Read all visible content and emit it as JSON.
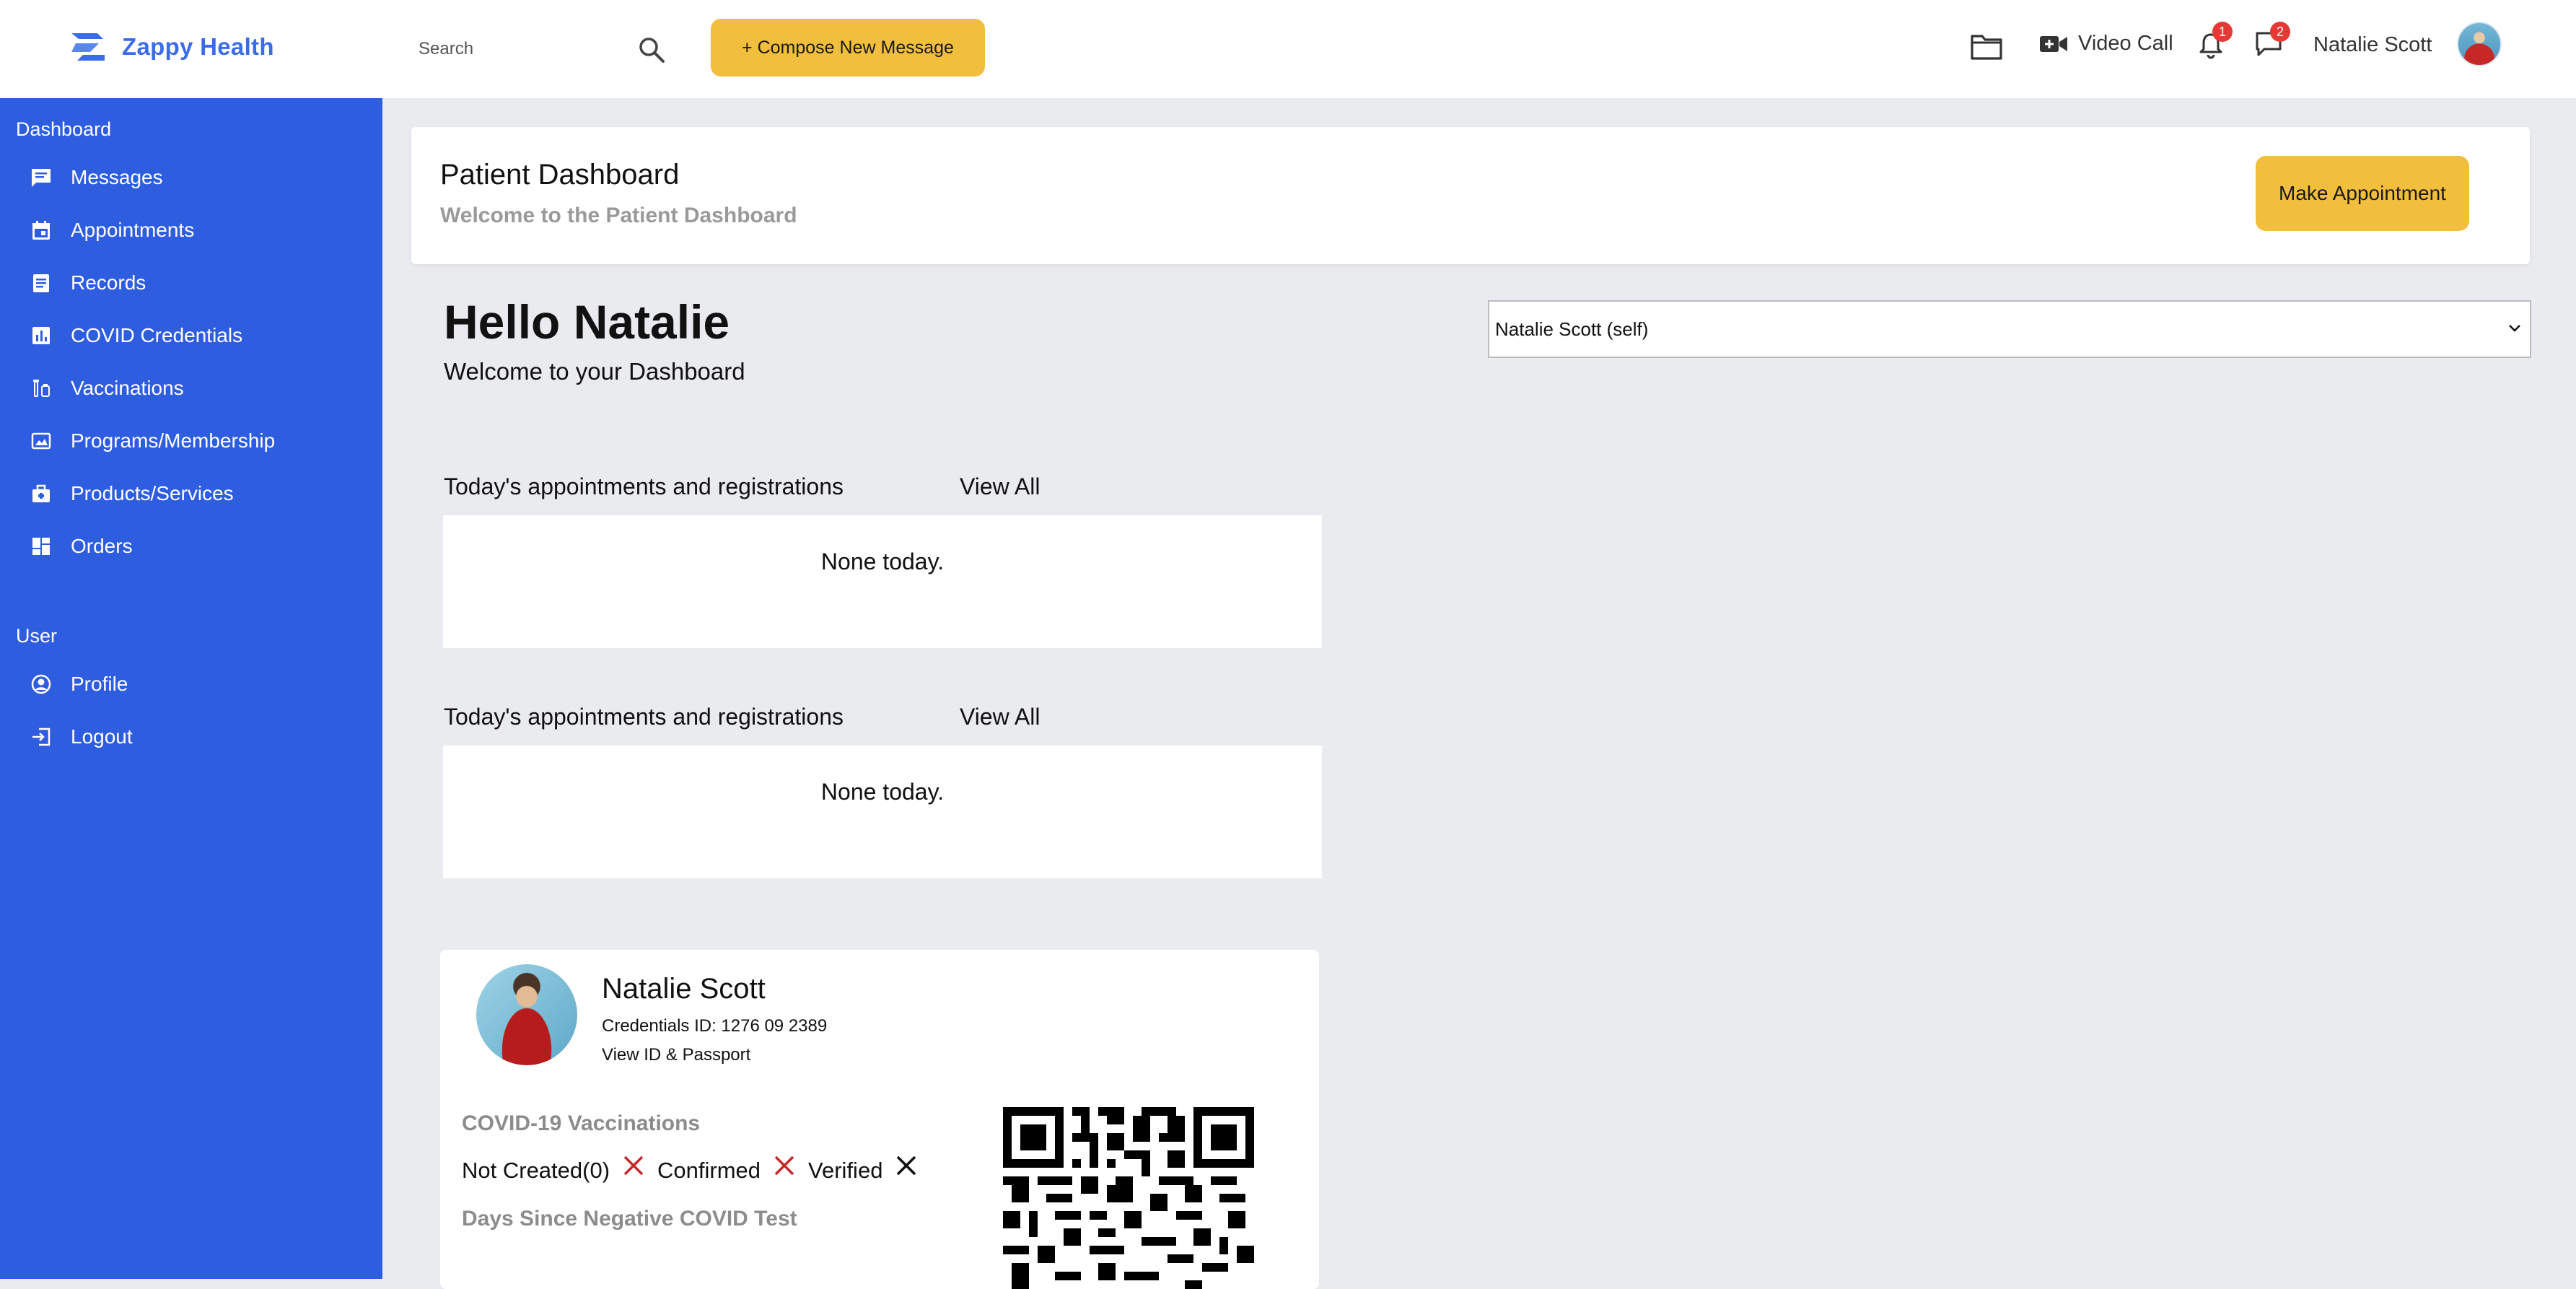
{
  "app": {
    "name": "Zappy Health"
  },
  "topbar": {
    "search_placeholder": "Search",
    "compose_label": "+ Compose New Message",
    "video_call_label": "Video Call",
    "notifications_count": "1",
    "messages_count": "2",
    "user_name": "Natalie Scott"
  },
  "sidebar": {
    "dashboard_section": "Dashboard",
    "items": [
      {
        "label": "Messages",
        "icon": "message-icon"
      },
      {
        "label": "Appointments",
        "icon": "calendar-icon"
      },
      {
        "label": "Records",
        "icon": "records-icon"
      },
      {
        "label": "COVID Credentials",
        "icon": "chart-icon"
      },
      {
        "label": "Vaccinations",
        "icon": "vaccine-icon"
      },
      {
        "label": "Programs/Membership",
        "icon": "programs-icon"
      },
      {
        "label": "Products/Services",
        "icon": "briefcase-icon"
      },
      {
        "label": "Orders",
        "icon": "grid-icon"
      }
    ],
    "user_section": "User",
    "user_items": [
      {
        "label": "Profile",
        "icon": "profile-icon"
      },
      {
        "label": "Logout",
        "icon": "logout-icon"
      }
    ]
  },
  "header": {
    "title": "Patient Dashboard",
    "subtitle": "Welcome to the Patient Dashboard",
    "make_appointment": "Make Appointment"
  },
  "greeting": {
    "hello": "Hello Natalie",
    "welcome": "Welcome to your Dashboard"
  },
  "patient_selector": {
    "selected": "Natalie Scott (self)"
  },
  "appointments": [
    {
      "heading": "Today's appointments and registrations",
      "view_all": "View All",
      "empty": "None today."
    },
    {
      "heading": "Today's appointments and registrations",
      "view_all": "View All",
      "empty": "None today."
    }
  ],
  "credential": {
    "name": "Natalie Scott",
    "credentials_id": "Credentials ID: 1276 09 2389",
    "view_id": "View ID & Passport",
    "vaccinations_heading": "COVID-19 Vaccinations",
    "status_not_created": "Not Created(0)",
    "status_confirmed": "Confirmed",
    "status_verified": "Verified",
    "negative_test_heading": "Days Since Negative COVID Test"
  },
  "colors": {
    "brand": "#3b6ce8",
    "sidebar": "#2f5de0",
    "accent_button": "#f2be3e",
    "badge": "#e53935",
    "cross_red": "#c62828"
  }
}
